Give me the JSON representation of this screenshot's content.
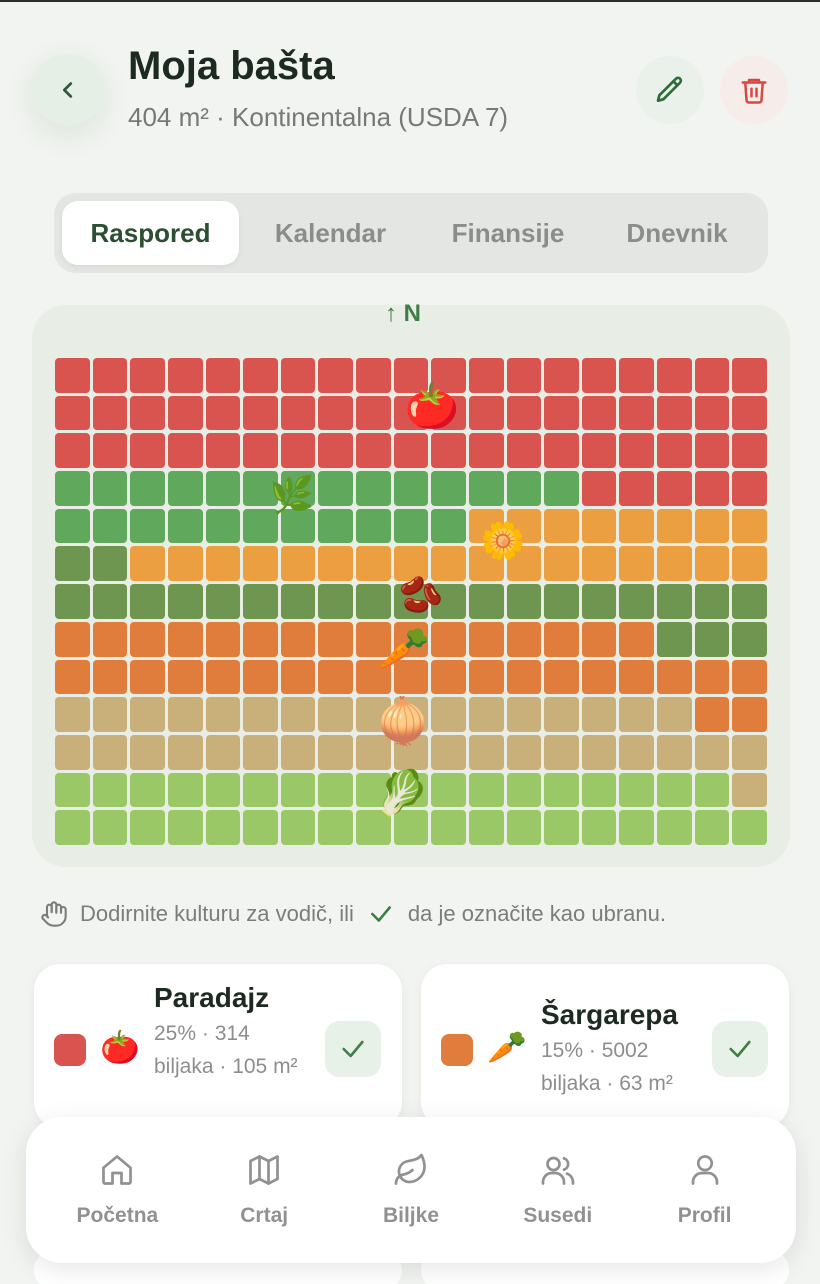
{
  "header": {
    "title": "Moja bašta",
    "subtitle": "404 m² · Kontinentalna (USDA 7)"
  },
  "tabs": [
    {
      "label": "Raspored",
      "active": true
    },
    {
      "label": "Kalendar",
      "active": false
    },
    {
      "label": "Finansije",
      "active": false
    },
    {
      "label": "Dnevnik",
      "active": false
    }
  ],
  "compass": "↑ N",
  "garden": {
    "columns": 19,
    "rows": 13,
    "legend_colors": {
      "T": "#d9534f",
      "G": "#5fa85c",
      "Y": "#ec9f41",
      "O": "#6f9650",
      "C": "#e07c3c",
      "N": "#c9b07b",
      "L": "#9ac866"
    },
    "layout": [
      "TTTTTTTTTTTTTTTTTTT",
      "TTTTTTTTTTTTTTTTTTT",
      "TTTTTTTTTTTTTTTTTTT",
      "GGGGGGGGGGGGGGTTTTT",
      "GGGGGGGGGGGYYYYYYYY",
      "OOYYYYYYYYYYYYYYYYY",
      "OOOOOOOOOOOOOOOOOOO",
      "CCCCCCCCCCCCCCCCOOO",
      "CCCCCCCCCCCCCCCCCCC",
      "NNNNNNNNNNNNNNNNNCC",
      "NNNNNNNNNNNNNNNNNNN",
      "LLLLLLLLLLLLLLLLLLN",
      "LLLLLLLLLLLLLLLLLLL"
    ],
    "crop_icons": [
      {
        "name": "tomato",
        "glyph": "🍅"
      },
      {
        "name": "herb",
        "glyph": "🌿"
      },
      {
        "name": "flower",
        "glyph": "🌼"
      },
      {
        "name": "beans",
        "glyph": "🫘"
      },
      {
        "name": "carrot",
        "glyph": "🥕"
      },
      {
        "name": "onion",
        "glyph": "🧅"
      },
      {
        "name": "lettuce",
        "glyph": "🥬"
      }
    ]
  },
  "hint": {
    "before": "Dodirnite kulturu za vodič, ili",
    "after": "da je označite kao ubranu."
  },
  "crops": [
    {
      "name": "Paradajz",
      "color": "#d9534f",
      "glyph": "🍅",
      "meta": "25% · 314 biljaka · 105 m²"
    },
    {
      "name": "Šargarepa",
      "color": "#e07c3c",
      "glyph": "🥕",
      "meta": "15% · 5002 biljaka · 63 m²"
    }
  ],
  "nav": [
    {
      "label": "Početna",
      "icon": "home-icon"
    },
    {
      "label": "Crtaj",
      "icon": "map-icon"
    },
    {
      "label": "Biljke",
      "icon": "leaf-icon"
    },
    {
      "label": "Susedi",
      "icon": "users-icon"
    },
    {
      "label": "Profil",
      "icon": "user-icon"
    }
  ]
}
